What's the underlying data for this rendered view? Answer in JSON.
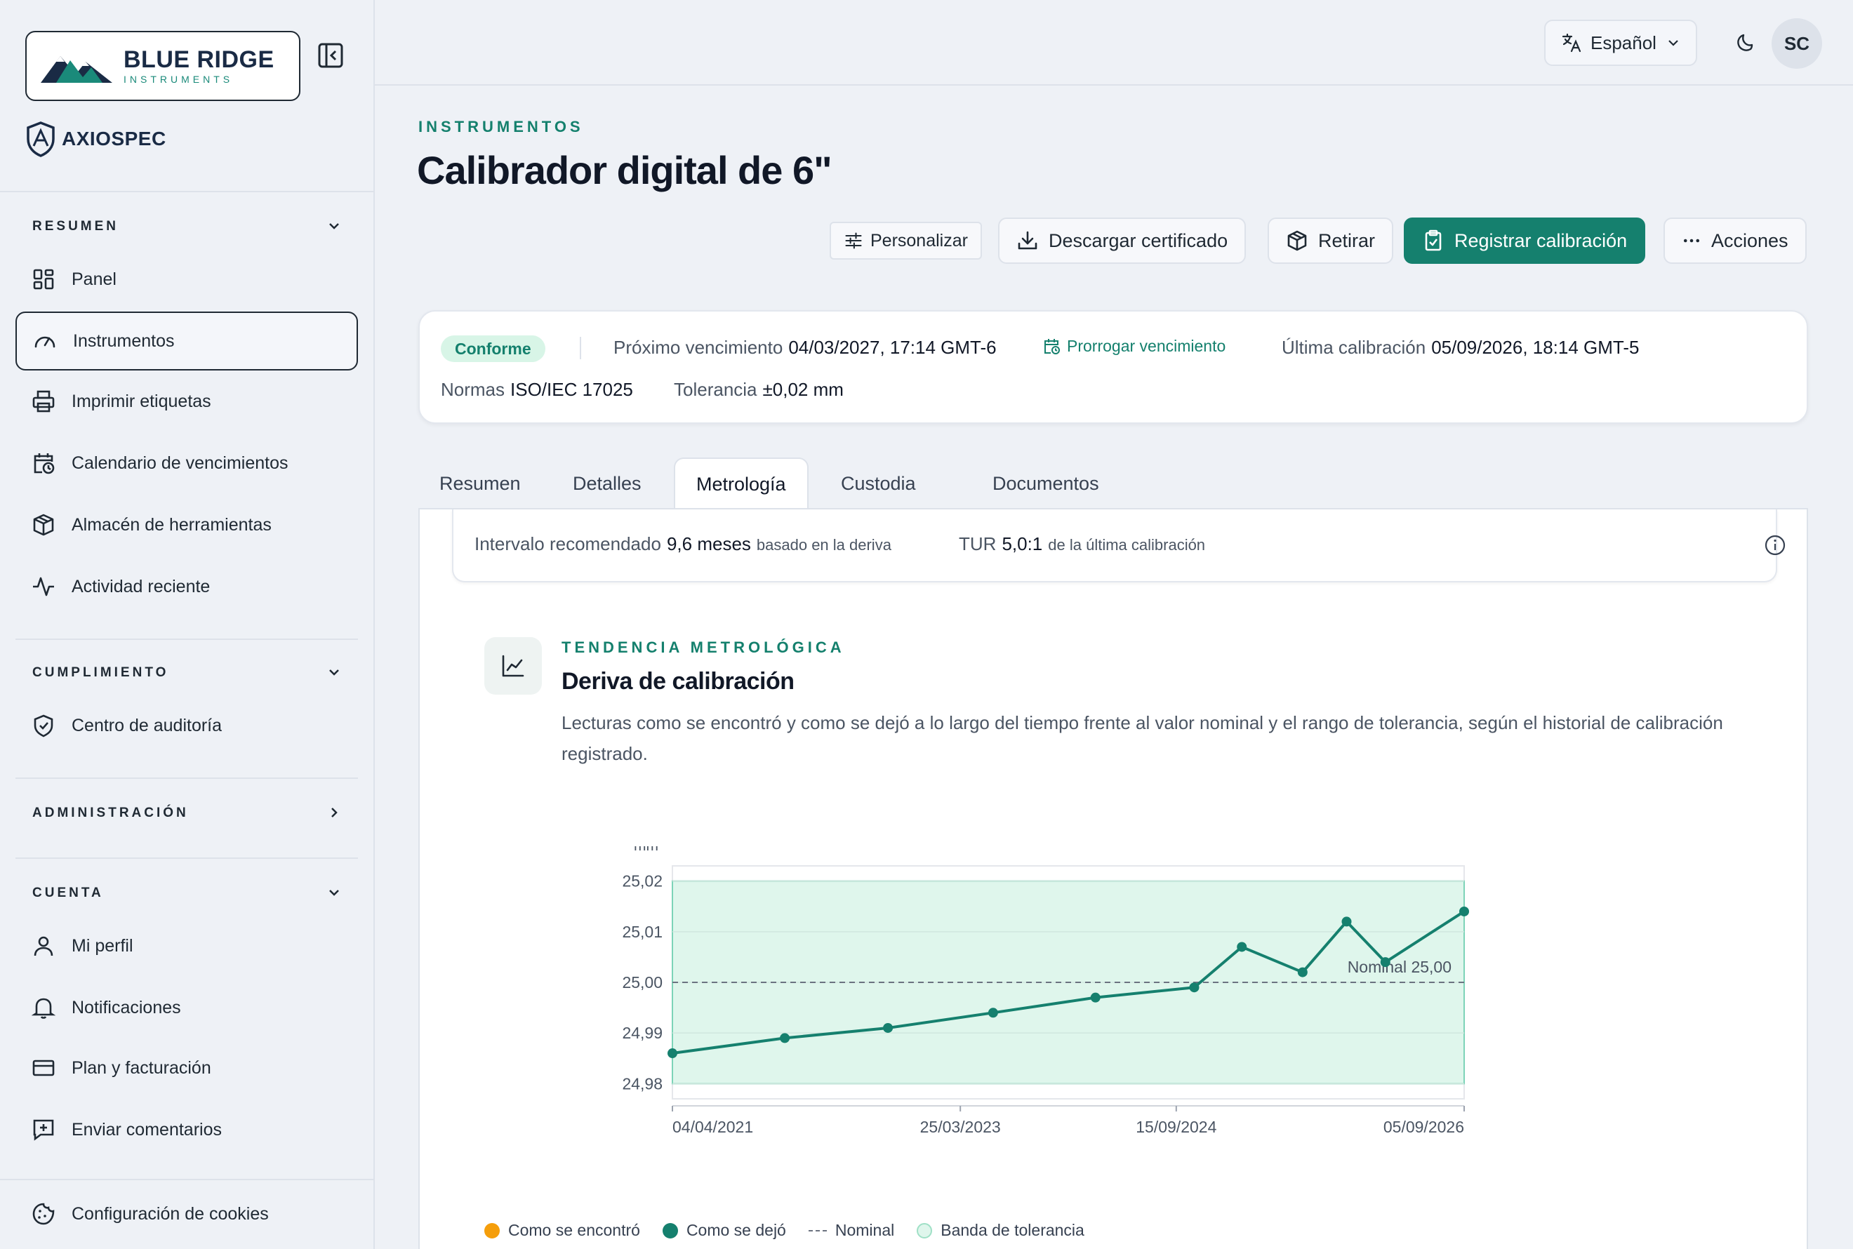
{
  "brand": {
    "logo_main": "BLUE RIDGE",
    "logo_sub": "INSTRUMENTS",
    "product": "AXIOSPEC"
  },
  "sidebar": {
    "sections": [
      {
        "label": "RESUMEN",
        "items": [
          "Panel",
          "Instrumentos",
          "Imprimir etiquetas",
          "Calendario de vencimientos",
          "Almacén de herramientas",
          "Actividad reciente"
        ]
      },
      {
        "label": "CUMPLIMIENTO",
        "items": [
          "Centro de auditoría"
        ]
      },
      {
        "label": "ADMINISTRACIÓN",
        "items": []
      },
      {
        "label": "CUENTA",
        "items": [
          "Mi perfil",
          "Notificaciones",
          "Plan y facturación",
          "Enviar comentarios"
        ]
      }
    ],
    "footer_item": "Configuración de cookies",
    "active_item": "Instrumentos"
  },
  "header": {
    "language": "Español",
    "avatar_initials": "SC"
  },
  "page": {
    "eyebrow": "INSTRUMENTOS",
    "title": "Calibrador digital de 6\"",
    "actions": {
      "customize": "Personalizar",
      "download": "Descargar certificado",
      "retire": "Retirar",
      "register": "Registrar calibración",
      "more": "Acciones"
    }
  },
  "summary": {
    "status": "Conforme",
    "next_due_label": "Próximo vencimiento",
    "next_due_value": "04/03/2027, 17:14 GMT-6",
    "extend_label": "Prorrogar vencimiento",
    "last_cal_label": "Última calibración",
    "last_cal_value": "05/09/2026, 18:14 GMT-5",
    "standards_label": "Normas",
    "standards_value": "ISO/IEC 17025",
    "tolerance_label": "Tolerancia",
    "tolerance_value": "±0,02 mm"
  },
  "tabs": [
    "Resumen",
    "Detalles",
    "Metrología",
    "Custodia",
    "Documentos"
  ],
  "active_tab": "Metrología",
  "recommendation": {
    "interval_label": "Intervalo recomendado",
    "interval_value": "9,6 meses",
    "interval_note": "basado en la deriva",
    "tur_label": "TUR",
    "tur_value": "5,0:1",
    "tur_note": "de la última calibración"
  },
  "trend": {
    "eyebrow": "TENDENCIA METROLÓGICA",
    "title": "Deriva de calibración",
    "description": "Lecturas como se encontró y como se dejó a lo largo del tiempo frente al valor nominal y el rango de tolerancia, según el historial de calibración registrado."
  },
  "chart_data": {
    "type": "line",
    "ylabel": "mm",
    "ylim": [
      24.977,
      25.023
    ],
    "yticks": [
      24.98,
      24.99,
      25.0,
      25.01,
      25.02
    ],
    "ytick_labels": [
      "24,98",
      "24,99",
      "25,00",
      "25,01",
      "25,02"
    ],
    "xticks": [
      "04/04/2021",
      "25/03/2023",
      "15/09/2024",
      "05/09/2026"
    ],
    "xtick_dates": [
      "2021-04-04",
      "2023-03-25",
      "2024-09-15",
      "2026-09-05"
    ],
    "x_range_dates": [
      "2021-04-04",
      "2026-09-05"
    ],
    "nominal": 25.0,
    "nominal_label": "Nominal 25,00",
    "tolerance_band": [
      24.98,
      25.02
    ],
    "series": [
      {
        "name": "Como se dejó",
        "color": "#15806e",
        "x": [
          "2021-04-04",
          "2022-01-10",
          "2022-09-25",
          "2023-06-15",
          "2024-02-26",
          "2024-10-30",
          "2025-07-28",
          "2026-02-20",
          "2026-09-05"
        ],
        "values": [
          24.986,
          24.989,
          24.991,
          24.994,
          24.997,
          24.999,
          25.002,
          25.004,
          25.014
        ]
      },
      {
        "name": "Como se encontró",
        "color": "#f59e0b",
        "x": [],
        "values": []
      }
    ],
    "series_inner": [
      {
        "x": [
          "2025-02-26",
          "2025-11-15"
        ],
        "values": [
          25.007,
          25.012
        ]
      }
    ],
    "legend": [
      "Como se encontró",
      "Como se dejó",
      "Nominal",
      "Banda de tolerancia"
    ],
    "colors": {
      "found": "#f59e0b",
      "left": "#15806e",
      "band": "#dff6ec",
      "band_stroke": "#7dd3b8"
    }
  }
}
